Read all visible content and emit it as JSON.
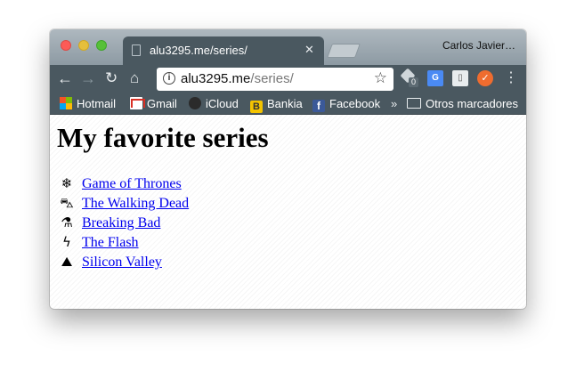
{
  "browser": {
    "tab": {
      "title": "alu3295.me/series/",
      "close_glyph": "✕"
    },
    "profile_name": "Carlos Javier…",
    "toolbar": {
      "back_glyph": "←",
      "forward_glyph": "→",
      "reload_glyph": "↻",
      "home_glyph": "⌂",
      "menu_glyph": "⋮",
      "info_glyph": "i",
      "star_glyph": "☆"
    },
    "url": {
      "host": "alu3295.me",
      "path": "/series/"
    },
    "extensions": {
      "ext1_badge": "0",
      "ext2_label": "G",
      "ext3_label": "▯",
      "ext4_label": "✓"
    },
    "bookmarks": [
      {
        "label": "Hotmail"
      },
      {
        "label": "Gmail"
      },
      {
        "label": "iCloud"
      },
      {
        "label": "Bankia",
        "icon_text": "B"
      },
      {
        "label": "Facebook",
        "icon_text": "f"
      }
    ],
    "bookmarks_more": "»",
    "other_bookmarks": "Otros marcadores"
  },
  "page": {
    "title": "My favorite series",
    "series": [
      {
        "icon": "❄",
        "icon_name": "snowflake-icon",
        "label": "Game of Thrones"
      },
      {
        "icon": "⛍",
        "icon_name": "road-icon",
        "label": "The Walking Dead"
      },
      {
        "icon": "⚗",
        "icon_name": "flask-icon",
        "label": "Breaking Bad"
      },
      {
        "icon": "ϟ",
        "icon_name": "lightning-bolt-icon",
        "label": "The Flash"
      },
      {
        "icon": "⛰",
        "icon_name": "valley-icon",
        "label": "Silicon Valley"
      }
    ]
  },
  "colors": {
    "link": "#0000ee",
    "chrome_dark": "#4a5860",
    "close_dot": "#fc5b57",
    "min_dot": "#e5bf3c",
    "max_dot": "#57c038"
  }
}
